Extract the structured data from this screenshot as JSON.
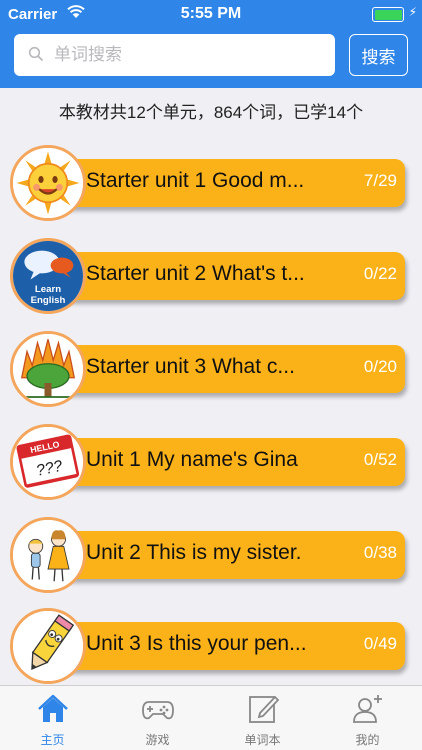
{
  "status_bar": {
    "carrier": "Carrier",
    "time": "5:55 PM",
    "battery_color": "#3ad45b"
  },
  "search": {
    "placeholder": "单词搜索",
    "button_label": "搜索"
  },
  "summary": "本教材共12个单元，864个词，已学14个",
  "colors": {
    "accent": "#2f86e8",
    "bar": "#fbb219",
    "ring": "#f4a65c"
  },
  "units": [
    {
      "title": "Starter unit 1 Good m...",
      "progress": "7/29",
      "icon": "sun-icon"
    },
    {
      "title": "Starter unit 2 What's t...",
      "progress": "0/22",
      "icon": "learn-english-icon",
      "icon_text": "Learn English"
    },
    {
      "title": "Starter unit 3 What c...",
      "progress": "0/20",
      "icon": "tree-icon"
    },
    {
      "title": "Unit 1 My name's Gina",
      "progress": "0/52",
      "icon": "name-tag-icon",
      "icon_text": "HELLO",
      "icon_text2": "???"
    },
    {
      "title": "Unit 2 This is my sister.",
      "progress": "0/38",
      "icon": "children-icon"
    },
    {
      "title": "Unit 3 Is this your pen...",
      "progress": "0/49",
      "icon": "pencil-icon"
    }
  ],
  "tabs": [
    {
      "label": "主页",
      "icon": "home-icon",
      "active": true
    },
    {
      "label": "游戏",
      "icon": "gamepad-icon",
      "active": false
    },
    {
      "label": "单词本",
      "icon": "notebook-icon",
      "active": false
    },
    {
      "label": "我的",
      "icon": "profile-icon",
      "active": false
    }
  ]
}
